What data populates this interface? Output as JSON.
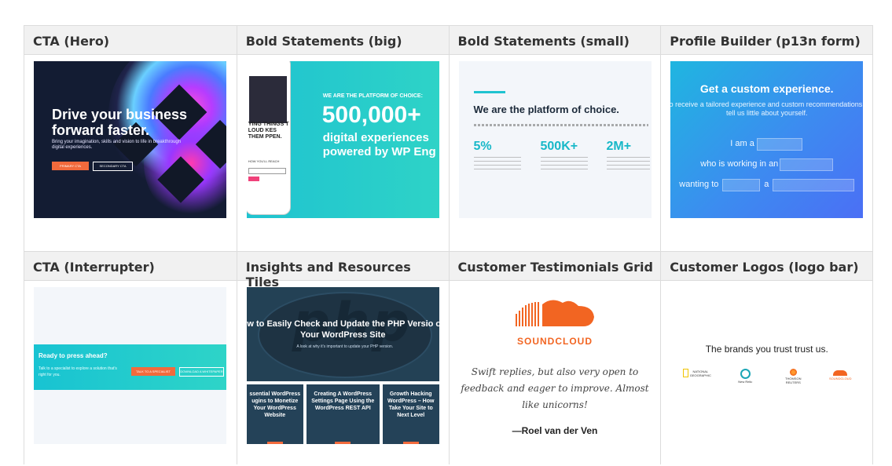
{
  "headers_row1": [
    "CTA (Hero)",
    "Bold Statements (big)",
    "Bold Statements (small)",
    "Profile Builder (p13n form)"
  ],
  "headers_row2": [
    "CTA (Interrupter)",
    "Insights and Resources Tiles",
    "Customer Testimonials Grid",
    "Customer Logos (logo bar)"
  ],
  "hero": {
    "headline": "Drive your business forward faster.",
    "body": "Bring your imagination, skills and vision to life in breakthrough digital experiences.",
    "primary": "PRIMARY CTA",
    "secondary": "SECONDARY CTA"
  },
  "bold_big": {
    "phone_text": "YING THINGS T LOUD KES THEM PPEN.",
    "phone_small": "HOW YOU'LL REACH",
    "eyebrow": "WE ARE THE PLATFORM OF CHOICE:",
    "number": "500,000+",
    "line1": "digital experiences",
    "line2": "powered by WP Eng"
  },
  "bold_small": {
    "title": "We are the platform of choice.",
    "stats": [
      "5%",
      "500K+",
      "2M+"
    ]
  },
  "profile": {
    "title": "Get a custom experience.",
    "subtitle": "o receive a tailored experience and custom recommendations, tell us little about yourself.",
    "i_am": "I am a",
    "working": "who is working in an",
    "wanting": "wanting to",
    "a": "a"
  },
  "interrupter": {
    "heading": "Ready to press ahead?",
    "body": "Talk to a specialist to explore a solution that's right for you.",
    "primary": "TALK TO A SPECIALIST",
    "secondary": "DOWNLOAD A WHITEPAPER"
  },
  "insights": {
    "php": "php",
    "title": "ow to Easily Check and Update the PHP Versio of Your WordPress Site",
    "sub": "A look at why it's important to update your PHP version.",
    "tiles": [
      "ssential WordPress ugins to Monetize Your WordPress Website",
      "Creating A WordPress Settings Page Using the WordPress REST API",
      "Growth Hacking WordPress – How Take Your Site to Next Level"
    ]
  },
  "testimonial": {
    "brand": "SOUNDCLOUD",
    "quote": "Swift replies, but also very open to feedback and eager to improve. Almost like unicorns!",
    "author": "—Roel van der Ven"
  },
  "logos": {
    "title": "The brands you trust  trust us.",
    "items": [
      "NATIONAL GEOGRAPHIC",
      "New Relic",
      "THOMSON REUTERS",
      "SOUNDCLOUD"
    ]
  },
  "colors": {
    "accent": "#1fc3d0",
    "orange": "#f26a3c",
    "soundcloud": "#f26522",
    "header_bg": "#f1f1f1"
  }
}
